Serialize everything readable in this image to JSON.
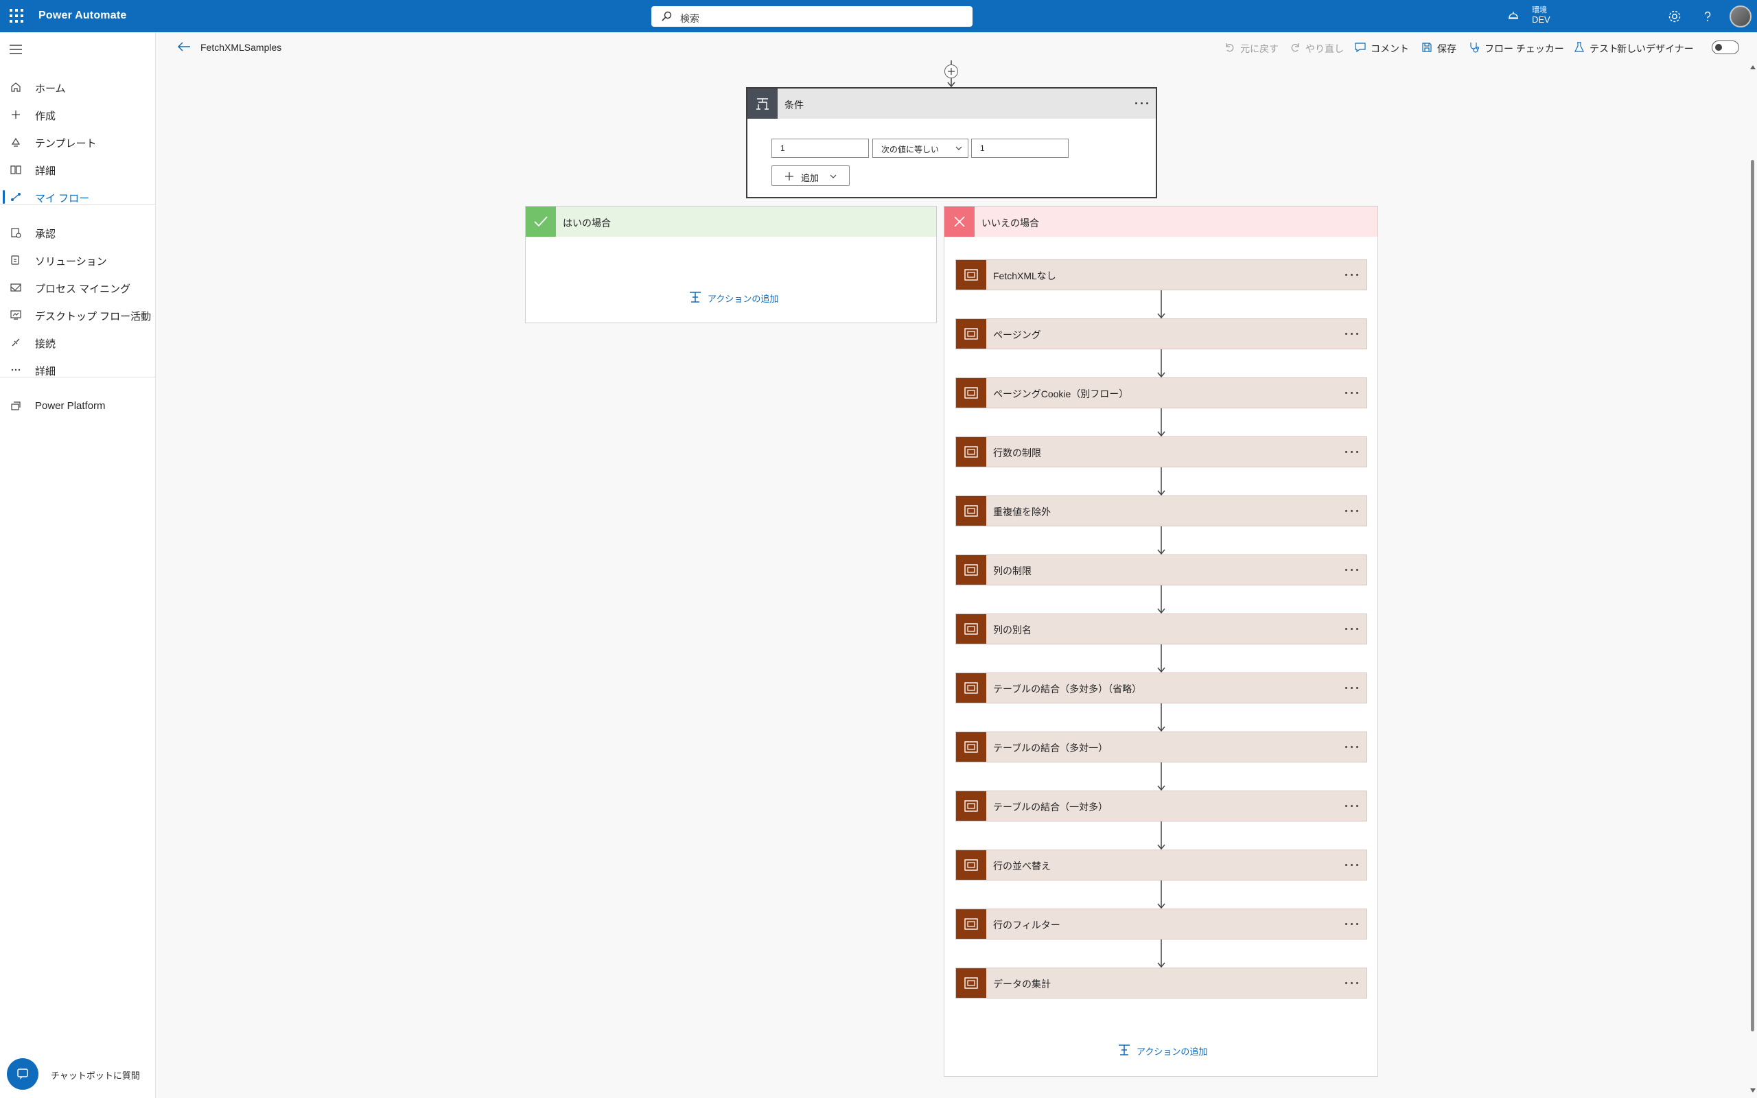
{
  "app": {
    "title": "Power Automate"
  },
  "search": {
    "placeholder": "検索"
  },
  "environment": {
    "label": "環境",
    "name": "DEV"
  },
  "icons": {
    "waffle": "app-launcher-icon",
    "search": "search-icon",
    "environment": "environment-icon",
    "settings": "gear-icon",
    "help": "help-icon"
  },
  "sidebar": {
    "items": [
      {
        "label": "ホーム",
        "icon": "home-icon"
      },
      {
        "label": "作成",
        "icon": "plus-icon"
      },
      {
        "label": "テンプレート",
        "icon": "template-icon"
      },
      {
        "label": "詳細",
        "icon": "book-icon"
      },
      {
        "label": "マイ フロー",
        "icon": "flow-icon",
        "active": true
      },
      {
        "label": "承認",
        "icon": "approval-icon"
      },
      {
        "label": "ソリューション",
        "icon": "solution-icon"
      },
      {
        "label": "プロセス マイニング",
        "icon": "process-mining-icon"
      },
      {
        "label": "デスクトップ フロー活動",
        "icon": "desktop-flow-icon"
      },
      {
        "label": "接続",
        "icon": "connection-icon"
      },
      {
        "label": "詳細",
        "icon": "more-icon"
      },
      {
        "label": "Power Platform",
        "icon": "power-platform-icon"
      }
    ],
    "chatbot_label": "チャットボットに質問"
  },
  "command_bar": {
    "flow_name": "FetchXMLSamples",
    "undo": "元に戻す",
    "redo": "やり直し",
    "comment": "コメント",
    "save": "保存",
    "flow_checker": "フロー チェッカー",
    "test": "テスト",
    "new_designer": "新しいデザイナー"
  },
  "condition": {
    "title": "条件",
    "left_value": "1",
    "operator": "次の値に等しい",
    "right_value": "1",
    "add_label": "追加"
  },
  "yes_branch": {
    "title": "はいの場合",
    "add_action": "アクションの追加",
    "color": "#e7f4e4",
    "icon_color": "#72c26a"
  },
  "no_branch": {
    "title": "いいえの場合",
    "add_action": "アクションの追加",
    "color": "#fde7e9",
    "icon_color": "#f1707b",
    "actions": [
      "FetchXMLなし",
      "ページング",
      "ページングCookie（別フロー）",
      "行数の制限",
      "重複値を除外",
      "列の制限",
      "列の別名",
      "テーブルの結合（多対多）（省略）",
      "テーブルの結合（多対一）",
      "テーブルの結合（一対多）",
      "行の並べ替え",
      "行のフィルター",
      "データの集計"
    ]
  },
  "colors": {
    "brand": "#0f6cbd",
    "action_header": "#ede1db",
    "action_icon": "#8b3a0f"
  }
}
